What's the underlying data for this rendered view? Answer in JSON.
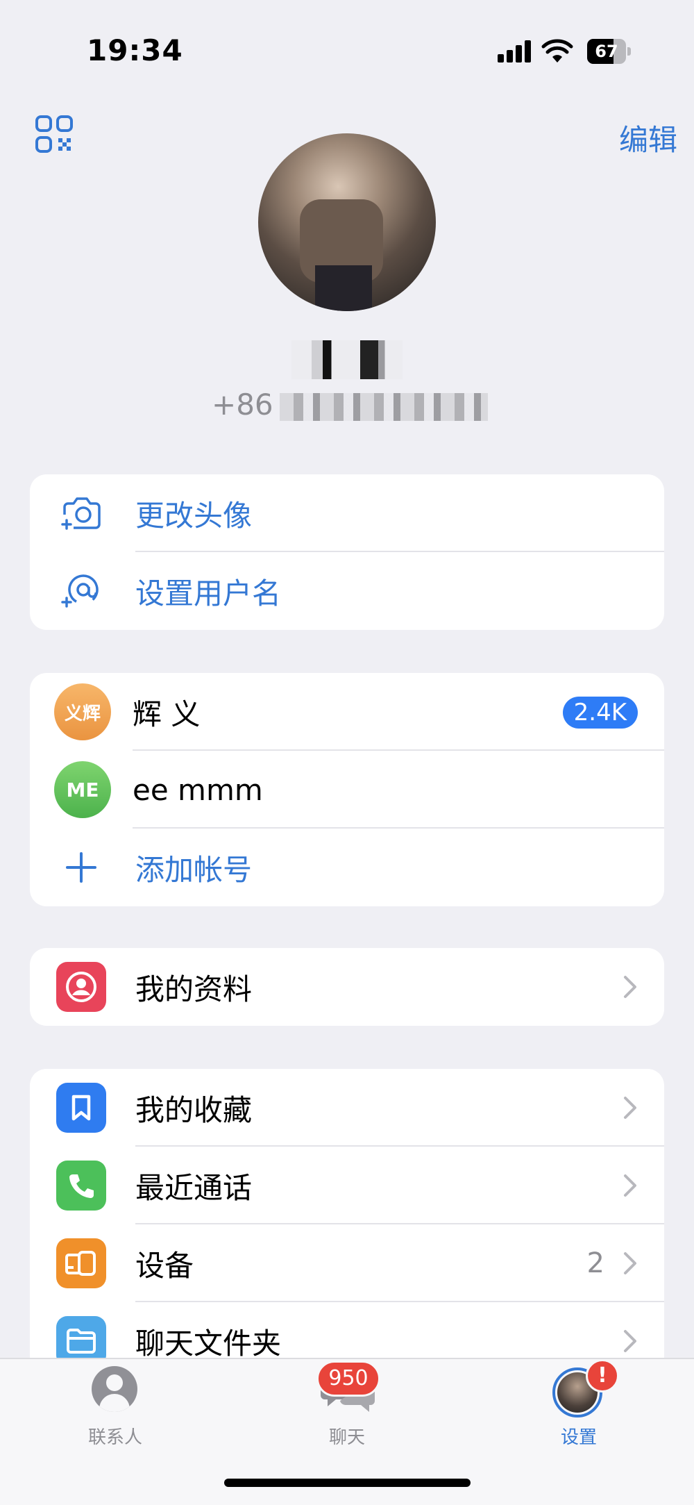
{
  "status_bar": {
    "time": "19:34",
    "battery": "67",
    "battery_level": 0.67
  },
  "header": {
    "edit_label": "编辑",
    "phone_prefix": "+86"
  },
  "profile_actions": [
    {
      "label": "更改头像",
      "icon": "camera-plus-icon"
    },
    {
      "label": "设置用户名",
      "icon": "at-sign-plus-icon"
    }
  ],
  "accounts": {
    "items": [
      {
        "avatar_text": "义辉",
        "name": "辉 义",
        "badge": "2.4K",
        "avatar_color": "#f0a048"
      },
      {
        "avatar_text": "ME",
        "name": "ee mmm",
        "badge": "",
        "avatar_color": "#5cbf5a"
      }
    ],
    "add_label": "添加帐号"
  },
  "profile_menu": {
    "label": "我的资料",
    "icon": "person-icon",
    "color": "#e8445a"
  },
  "menu": [
    {
      "label": "我的收藏",
      "icon": "bookmark-icon",
      "color": "#2f7cf0",
      "detail": ""
    },
    {
      "label": "最近通话",
      "icon": "phone-icon",
      "color": "#4cc05a",
      "detail": ""
    },
    {
      "label": "设备",
      "icon": "devices-icon",
      "color": "#f0902a",
      "detail": "2"
    },
    {
      "label": "聊天文件夹",
      "icon": "folder-icon",
      "color": "#4ea8e8",
      "detail": ""
    }
  ],
  "tabbar": {
    "tabs": [
      {
        "label": "联系人",
        "icon": "person-circle-icon"
      },
      {
        "label": "聊天",
        "icon": "chat-bubbles-icon",
        "badge": "950"
      },
      {
        "label": "设置",
        "icon": "settings-avatar-icon",
        "badge": "!"
      }
    ],
    "active": "设置"
  }
}
